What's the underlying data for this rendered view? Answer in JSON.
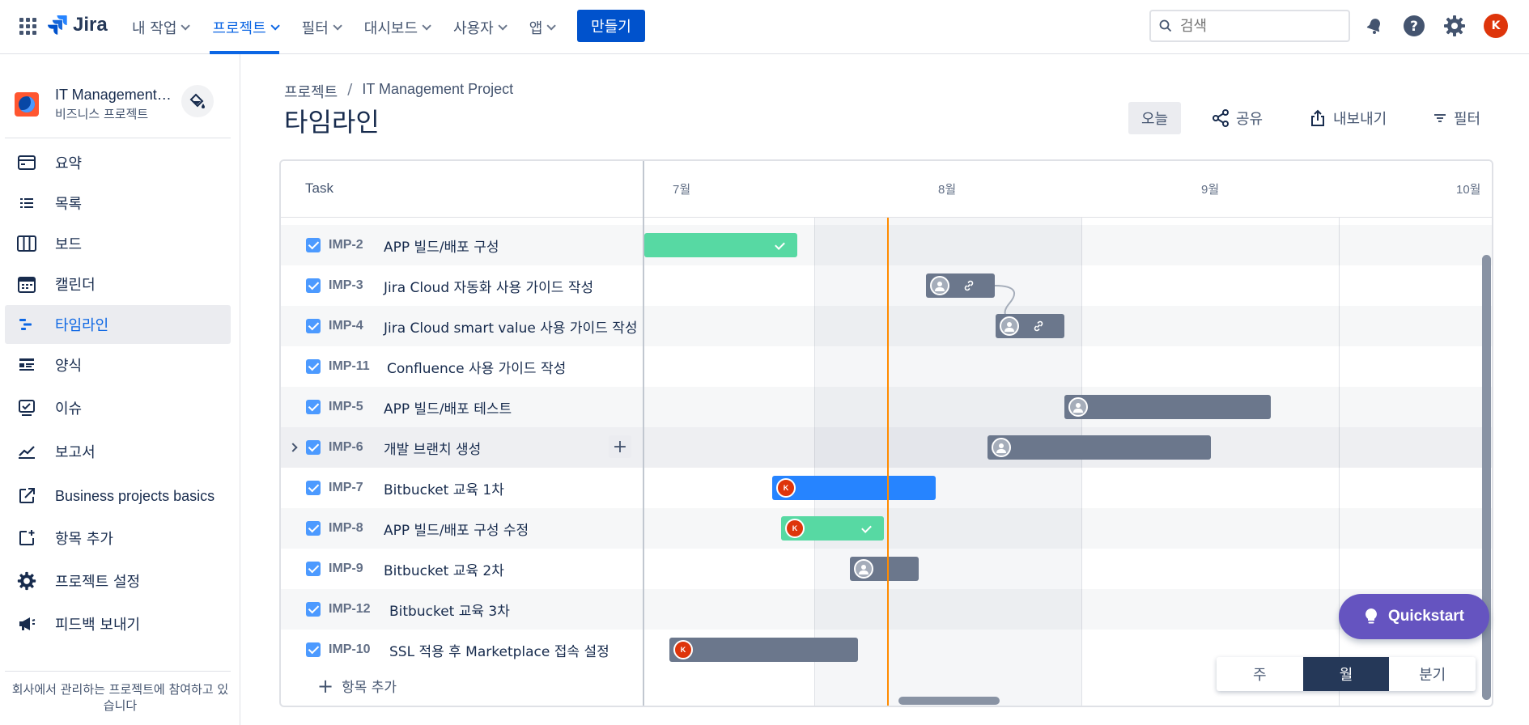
{
  "topnav": {
    "logo": "Jira",
    "menu": [
      {
        "label": "내 작업",
        "active": false
      },
      {
        "label": "프로젝트",
        "active": true
      },
      {
        "label": "필터",
        "active": false
      },
      {
        "label": "대시보드",
        "active": false
      },
      {
        "label": "사용자",
        "active": false
      },
      {
        "label": "앱",
        "active": false
      }
    ],
    "create_label": "만들기",
    "search_placeholder": "검색",
    "avatar_initial": "K"
  },
  "sidebar": {
    "project_name": "IT Management Project",
    "project_type": "비즈니스 프로젝트",
    "items": [
      {
        "label": "요약",
        "icon": "summary-icon",
        "active": false
      },
      {
        "label": "목록",
        "icon": "list-icon",
        "active": false
      },
      {
        "label": "보드",
        "icon": "board-icon",
        "active": false
      },
      {
        "label": "캘린더",
        "icon": "calendar-icon",
        "active": false
      },
      {
        "label": "타임라인",
        "icon": "timeline-icon",
        "active": true
      },
      {
        "label": "양식",
        "icon": "form-icon",
        "active": false
      },
      {
        "label": "이슈",
        "icon": "issue-icon",
        "active": false
      },
      {
        "label": "보고서",
        "icon": "report-icon",
        "active": false
      },
      {
        "label": "Business projects basics",
        "icon": "external-link-icon",
        "active": false
      },
      {
        "label": "항목 추가",
        "icon": "add-item-icon",
        "active": false
      },
      {
        "label": "프로젝트 설정",
        "icon": "gear-icon",
        "active": false
      },
      {
        "label": "피드백 보내기",
        "icon": "megaphone-icon",
        "active": false
      }
    ],
    "footer": "회사에서 관리하는 프로젝트에 참여하고 있습니다"
  },
  "breadcrumb": {
    "root": "프로젝트",
    "separator": "/",
    "current": "IT Management Project"
  },
  "page_title": "타임라인",
  "toolbar": {
    "today": "오늘",
    "share": "공유",
    "export": "내보내기",
    "filter": "필터"
  },
  "timeline": {
    "task_header": "Task",
    "months": [
      "7월",
      "8월",
      "9월",
      "10월"
    ],
    "rows": [
      {
        "key": "IMP-2",
        "summary": "APP 빌드/배포 구성",
        "status": "done",
        "assignee": "none",
        "color": "#57d9a3",
        "done": true,
        "has_children": false
      },
      {
        "key": "IMP-3",
        "summary": "Jira Cloud 자동화 사용 가이드 작성",
        "status": "todo",
        "assignee": "unassigned",
        "color": "#6b778c",
        "done": false,
        "has_children": false,
        "linked": true
      },
      {
        "key": "IMP-4",
        "summary": "Jira Cloud smart value 사용 가이드 작성",
        "status": "todo",
        "assignee": "unassigned",
        "color": "#6b778c",
        "done": false,
        "has_children": false,
        "linked": true
      },
      {
        "key": "IMP-11",
        "summary": "Confluence 사용 가이드 작성",
        "status": "todo",
        "assignee": "none",
        "color": "",
        "done": false,
        "has_children": false
      },
      {
        "key": "IMP-5",
        "summary": "APP 빌드/배포 테스트",
        "status": "todo",
        "assignee": "unassigned",
        "color": "#6b778c",
        "done": false,
        "has_children": false
      },
      {
        "key": "IMP-6",
        "summary": "개발 브랜치 생성",
        "status": "todo",
        "assignee": "unassigned",
        "color": "#6b778c",
        "done": false,
        "has_children": true
      },
      {
        "key": "IMP-7",
        "summary": "Bitbucket 교육 1차",
        "status": "in-progress",
        "assignee": "K",
        "color": "#2684ff",
        "done": false,
        "has_children": false
      },
      {
        "key": "IMP-8",
        "summary": "APP 빌드/배포 구성 수정",
        "status": "done",
        "assignee": "K",
        "color": "#57d9a3",
        "done": true,
        "has_children": false
      },
      {
        "key": "IMP-9",
        "summary": "Bitbucket 교육 2차",
        "status": "todo",
        "assignee": "unassigned",
        "color": "#6b778c",
        "done": false,
        "has_children": false
      },
      {
        "key": "IMP-12",
        "summary": "Bitbucket 교육 3차",
        "status": "todo",
        "assignee": "none",
        "color": "",
        "done": false,
        "has_children": false
      },
      {
        "key": "IMP-10",
        "summary": "SSL 적용 후 Marketplace 접속 설정",
        "status": "todo",
        "assignee": "K",
        "color": "#6b778c",
        "done": false,
        "has_children": false
      }
    ],
    "add_item": "항목 추가",
    "scale_options": [
      {
        "label": "주",
        "active": false
      },
      {
        "label": "월",
        "active": true
      },
      {
        "label": "분기",
        "active": false
      }
    ]
  },
  "quickstart": "Quickstart",
  "colors": {
    "primary": "#0052cc",
    "done": "#57d9a3",
    "in_progress": "#2684ff",
    "todo": "#6b778c",
    "today_line": "#ff8b00",
    "quickstart": "#6554c0"
  }
}
